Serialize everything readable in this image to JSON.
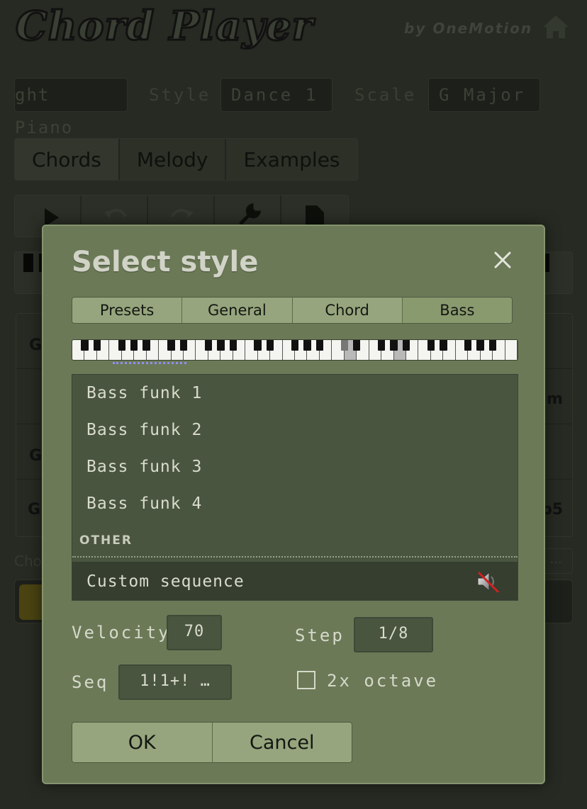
{
  "app": {
    "title": "Chord Player",
    "byline": "by OneMotion"
  },
  "background": {
    "instrument_value": "ght Piano",
    "style_label": "Style",
    "style_value": "Dance 1",
    "scale_label": "Scale",
    "scale_value": "G Major",
    "tabs": [
      "Chords",
      "Melody",
      "Examples"
    ],
    "grid_partial": [
      "G",
      "m",
      "G",
      "G",
      "b5"
    ],
    "chords_label_partial": "Cho",
    "ellipsis": "..."
  },
  "dialog": {
    "title": "Select style",
    "tabs": [
      {
        "label": "Presets",
        "active": false
      },
      {
        "label": "General",
        "active": false
      },
      {
        "label": "Chord",
        "active": false
      },
      {
        "label": "Bass",
        "active": true
      }
    ],
    "list": {
      "items": [
        "Bass funk 1",
        "Bass funk 2",
        "Bass funk 3",
        "Bass funk 4"
      ],
      "section": "OTHER",
      "selected": "Custom sequence"
    },
    "velocity": {
      "label": "Velocity",
      "value": "70"
    },
    "step": {
      "label": "Step",
      "value": "1/8"
    },
    "seq": {
      "label": "Seq",
      "value": "1!1+! …"
    },
    "octave": {
      "label": "2x octave",
      "checked": false
    },
    "buttons": {
      "ok": "OK",
      "cancel": "Cancel"
    }
  },
  "colors": {
    "dialog_bg": "#6b7957",
    "list_bg": "#4a5540",
    "button_bg": "#96a57d",
    "range_dots": "#8f8ff0"
  }
}
